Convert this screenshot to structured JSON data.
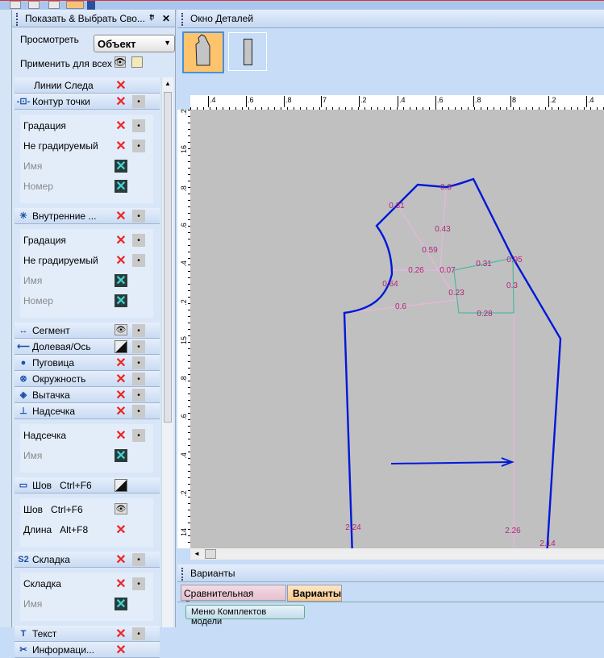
{
  "panel": {
    "title": "Показать & Выбрать Сво...",
    "view_label": "Просмотреть",
    "view_value": "Объект",
    "apply_all": "Применить для всех",
    "rows": [
      {
        "type": "h",
        "label": "Линии Следа",
        "icon": "trace-lines",
        "x": "red"
      },
      {
        "type": "h",
        "label": "Контур точки",
        "icon": "point-contour-icon",
        "x": "red",
        "dot": true
      },
      {
        "type": "s",
        "label": "Градация",
        "x": "red",
        "dot": true
      },
      {
        "type": "s",
        "label": "Не градируемый",
        "x": "red",
        "dot": true
      },
      {
        "type": "s",
        "label": "Имя",
        "x": "cyan",
        "gray": true
      },
      {
        "type": "s",
        "label": "Номер",
        "x": "cyan",
        "gray": true
      },
      {
        "type": "h",
        "label": "Внутренние ...",
        "icon": "internal-icon",
        "x": "red",
        "dot": true
      },
      {
        "type": "s",
        "label": "Градация",
        "x": "red",
        "dot": true
      },
      {
        "type": "s",
        "label": "Не градируемый",
        "x": "red",
        "dot": true
      },
      {
        "type": "s",
        "label": "Имя",
        "x": "cyan",
        "gray": true
      },
      {
        "type": "s",
        "label": "Номер",
        "x": "cyan",
        "gray": true
      },
      {
        "type": "h",
        "label": "Сегмент",
        "icon": "segment-icon",
        "x": "eye",
        "dot": true
      },
      {
        "type": "h",
        "label": "Долевая/Ось",
        "icon": "grainline-icon",
        "x": "half",
        "dot": true
      },
      {
        "type": "h",
        "label": "Пуговица",
        "icon": "button-icon",
        "x": "red",
        "dot": true
      },
      {
        "type": "h",
        "label": "Окружность",
        "icon": "circle-icon",
        "x": "red",
        "dot": true
      },
      {
        "type": "h",
        "label": "Вытачка",
        "icon": "dart-icon",
        "x": "red",
        "dot": true
      },
      {
        "type": "h",
        "label": "Надсечка",
        "icon": "notch-icon",
        "x": "red",
        "dot": true
      },
      {
        "type": "s",
        "label": "Надсечка",
        "x": "red",
        "dot": true
      },
      {
        "type": "s",
        "label": "Имя",
        "x": "cyan",
        "gray": true
      },
      {
        "type": "h",
        "label": "Шов   Ctrl+F6",
        "icon": "seam-icon",
        "x": "half"
      },
      {
        "type": "s",
        "label": "Шов   Ctrl+F6",
        "x": "eye"
      },
      {
        "type": "s",
        "label": "Длина   Alt+F8",
        "x": "red"
      },
      {
        "type": "h",
        "label": "Складка",
        "icon": "pleat-icon",
        "x": "red",
        "dot": true
      },
      {
        "type": "s",
        "label": "Складка",
        "x": "red",
        "dot": true
      },
      {
        "type": "s",
        "label": "Имя",
        "x": "cyan",
        "gray": true
      },
      {
        "type": "h",
        "label": "Текст",
        "icon": "text-icon",
        "x": "red",
        "dot": true
      },
      {
        "type": "h",
        "label": "Информаци...",
        "icon": "info-icon",
        "x": "red"
      }
    ]
  },
  "details": {
    "title": "Окно Деталей"
  },
  "ruler": {
    "top": [
      ".4",
      ".6",
      ".8",
      "7",
      ".2",
      ".4",
      ".6",
      ".8",
      "8",
      ".2",
      ".4"
    ],
    "left": [
      ".2",
      "16",
      ".8",
      ".6",
      ".4",
      ".2",
      "15",
      ".8",
      ".6",
      ".4",
      ".2",
      "14"
    ]
  },
  "labels": [
    "0.31",
    "0.3",
    "0.43",
    "0.59",
    "0.26",
    "0.07",
    "0.31",
    "0.95",
    "0.64",
    "0.23",
    "0.3",
    "0.6",
    "0.28",
    "2.24",
    "2.26",
    "2.14"
  ],
  "variants": {
    "title": "Варианты",
    "tabs": [
      "Сравнительная Длина",
      "Варианты"
    ],
    "active_tab": 1,
    "menu_button": "Меню Комплектов модели"
  }
}
